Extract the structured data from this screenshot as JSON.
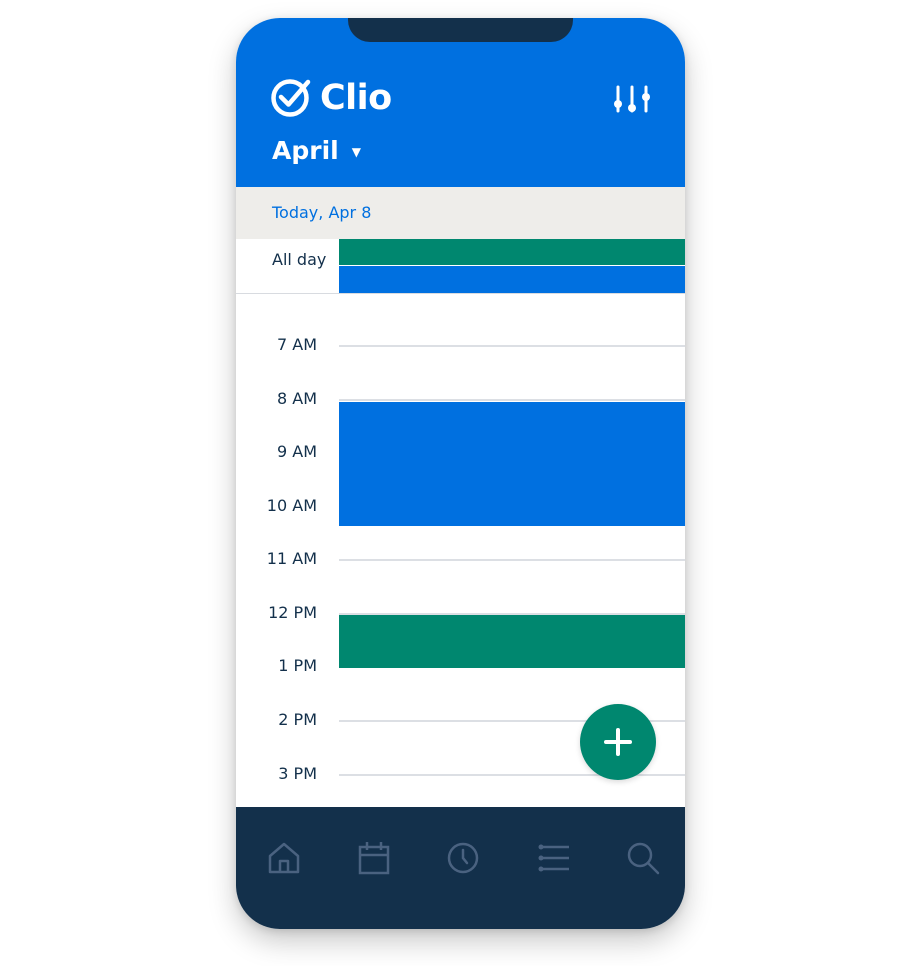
{
  "app": {
    "brand_name": "Clio",
    "accent_color": "#0070e0",
    "nav_color": "#13304b",
    "event_green": "#00876f"
  },
  "header": {
    "logo_icon": "clio-check-icon",
    "filter_icon": "sliders-icon",
    "month_label": "April",
    "month_caret": "▼"
  },
  "date_bar": {
    "label": "Today, Apr 8"
  },
  "all_day": {
    "label": "All day",
    "events": [
      {
        "color": "#00876f"
      },
      {
        "color": "#0070e0"
      }
    ]
  },
  "timeline": {
    "hours": [
      "7 AM",
      "8 AM",
      "9 AM",
      "10 AM",
      "11 AM",
      "12 PM",
      "1 PM",
      "2 PM",
      "3 PM"
    ],
    "events": [
      {
        "start": "8 AM",
        "end": "10:30 AM",
        "color": "#0070e0"
      },
      {
        "start": "12 PM",
        "end": "1 PM",
        "color": "#00876f"
      }
    ]
  },
  "fab": {
    "icon": "plus-icon"
  },
  "bottom_nav": {
    "items": [
      {
        "icon": "home-icon"
      },
      {
        "icon": "calendar-icon"
      },
      {
        "icon": "clock-icon"
      },
      {
        "icon": "list-icon"
      },
      {
        "icon": "search-icon"
      }
    ]
  }
}
